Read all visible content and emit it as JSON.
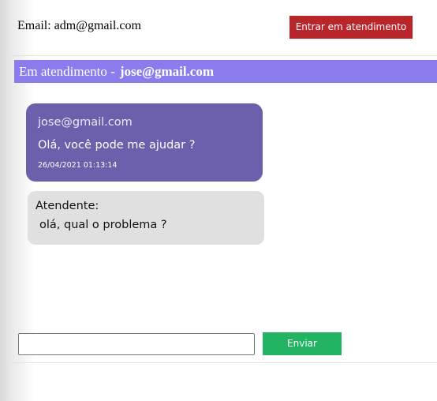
{
  "header": {
    "email_label": "Email: adm@gmail.com",
    "enter_button": "Entrar em atendimento"
  },
  "chat": {
    "title_prefix": "Em atendimento -",
    "title_user": "jose@gmail.com",
    "messages": [
      {
        "sender": "jose@gmail.com",
        "text": "Olá, você pode me ajudar ?",
        "timestamp": "26/04/2021 01:13:14"
      },
      {
        "sender": "Atendente:",
        "text": "olá, qual o problema ?"
      }
    ]
  },
  "composer": {
    "input_value": "",
    "send_button": "Enviar"
  },
  "colors": {
    "enter_button": "#b8262b",
    "chat_header": "#8a7ced",
    "user_bubble": "#6c5fac",
    "agent_bubble": "#e0e0e0",
    "send_button": "#22b463"
  }
}
